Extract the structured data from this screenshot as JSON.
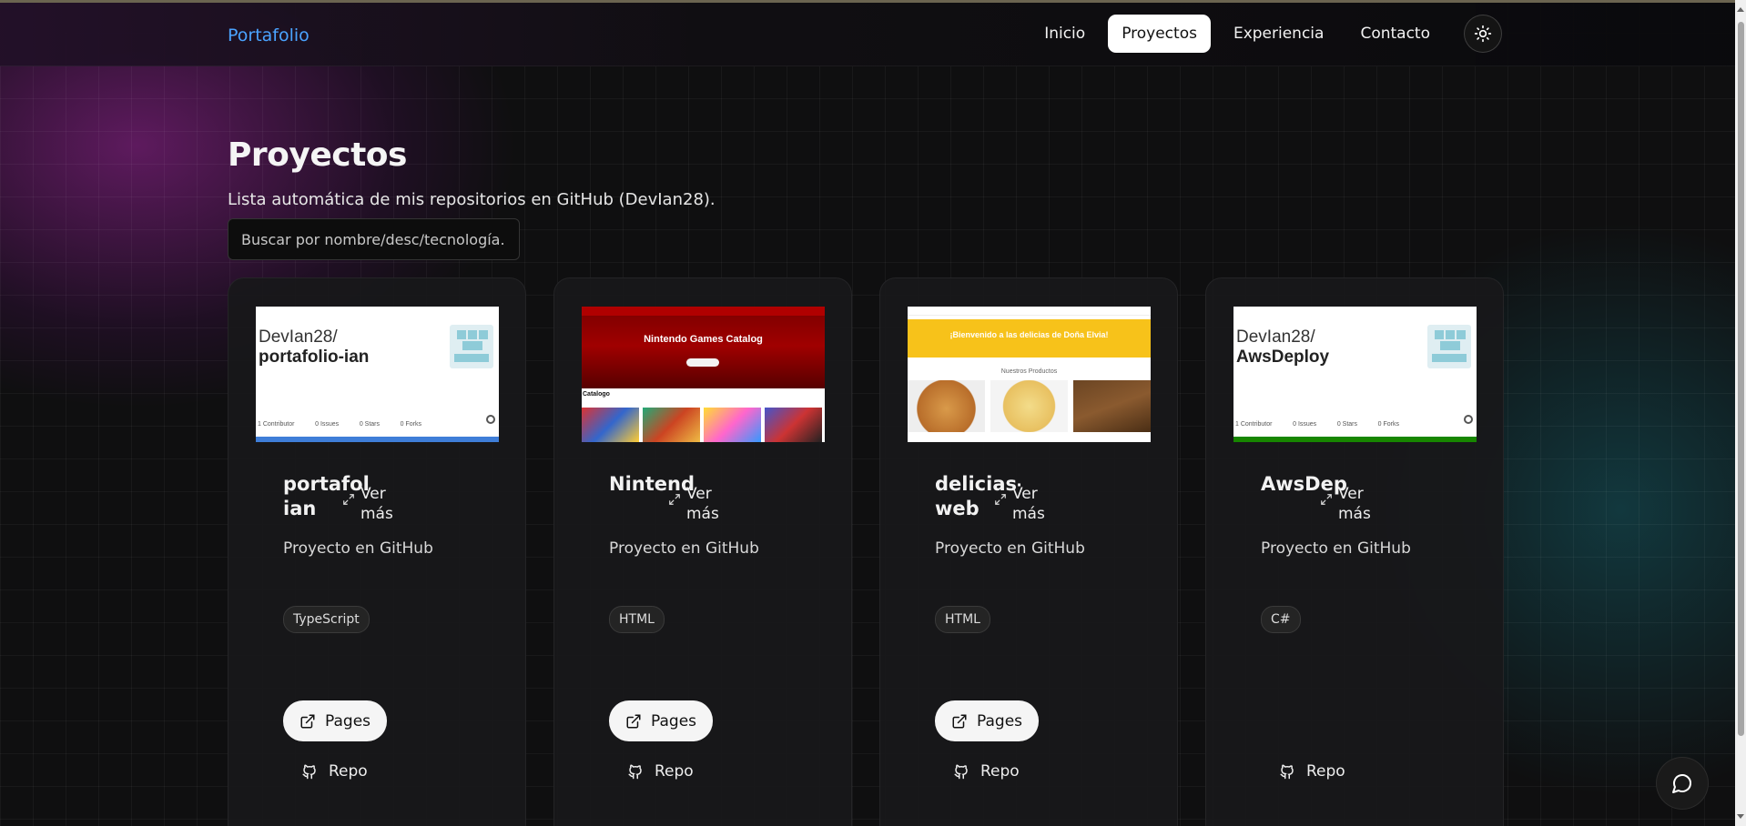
{
  "header": {
    "brand": "Portafolio",
    "nav": [
      {
        "label": "Inicio",
        "active": false
      },
      {
        "label": "Proyectos",
        "active": true
      },
      {
        "label": "Experiencia",
        "active": false
      },
      {
        "label": "Contacto",
        "active": false
      }
    ],
    "theme_icon": "sun-icon"
  },
  "page": {
    "title": "Proyectos",
    "subtitle": "Lista automática de mis repositorios en GitHub (DevIan28).",
    "search_placeholder": "Buscar por nombre/desc/tecnología..."
  },
  "cards": [
    {
      "title": "portafolio-ian",
      "view_more": "Ver más",
      "description": "Proyecto en GitHub",
      "tag": "TypeScript",
      "pages_label": "Pages",
      "repo_label": "Repo",
      "thumb": {
        "type": "github",
        "owner": "DevIan28/",
        "repo": "portafolio-ian",
        "bar_color": "#3f7ed8",
        "stats": [
          "1 Contributor",
          "0 Issues",
          "0 Stars",
          "0 Forks"
        ]
      }
    },
    {
      "title": "Nintendo",
      "view_more": "Ver más",
      "description": "Proyecto en GitHub",
      "tag": "HTML",
      "pages_label": "Pages",
      "repo_label": "Repo",
      "thumb": {
        "type": "nintendo",
        "heading": "Nintendo Games Catalog",
        "section": "Catalogo"
      }
    },
    {
      "title": "delicias-web",
      "view_more": "Ver más",
      "description": "Proyecto en GitHub",
      "tag": "HTML",
      "pages_label": "Pages",
      "repo_label": "Repo",
      "thumb": {
        "type": "delicias",
        "heading": "¡Bienvenido a las delicias de Doña Elvia!",
        "section": "Nuestros Productos"
      }
    },
    {
      "title": "AwsDeploy",
      "view_more": "Ver más",
      "description": "Proyecto en GitHub",
      "tag": "C#",
      "pages_label": "",
      "repo_label": "Repo",
      "thumb": {
        "type": "github",
        "owner": "DevIan28/",
        "repo": "AwsDeploy",
        "bar_color": "#178600",
        "stats": [
          "1 Contributor",
          "0 Issues",
          "0 Stars",
          "0 Forks"
        ]
      }
    }
  ],
  "chat_icon": "chat-bubble-icon"
}
